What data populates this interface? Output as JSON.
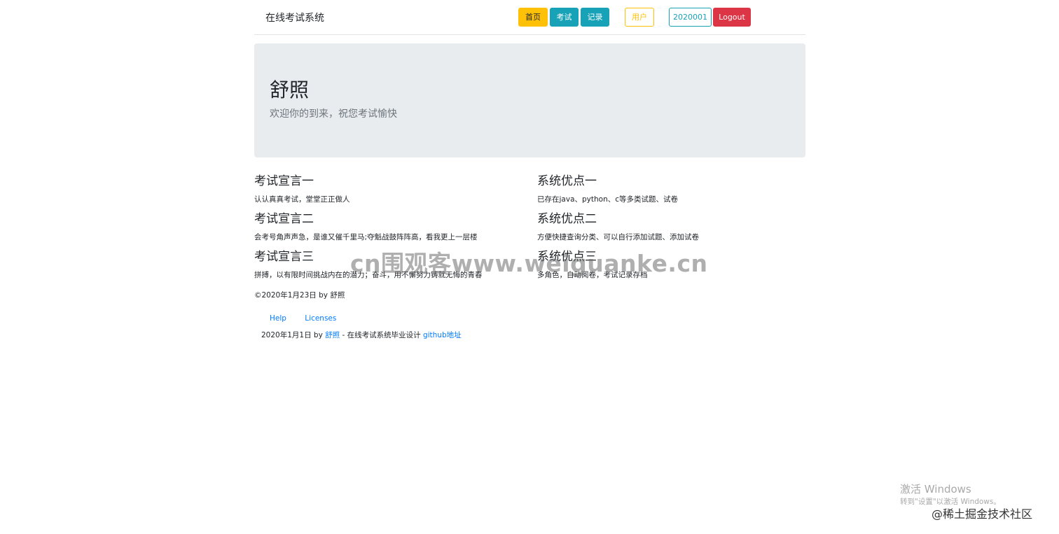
{
  "navbar": {
    "brand": "在线考试系统",
    "home": "首页",
    "exam": "考试",
    "record": "记录",
    "user": "用户",
    "user_id": "2020001",
    "logout": "Logout"
  },
  "jumbotron": {
    "title": "舒照",
    "subtitle": "欢迎你的到来，祝您考试愉快"
  },
  "left_column": [
    {
      "title": "考试宣言一",
      "text": "认认真真考试，堂堂正正做人"
    },
    {
      "title": "考试宣言二",
      "text": "会考号角声声急，是谁又催千里马;夺魁战鼓阵阵高，看我更上一层楼"
    },
    {
      "title": "考试宣言三",
      "text": "拼搏，以有限时间挑战内在的潜力；奋斗，用不懈努力铸就无悔的青春"
    }
  ],
  "right_column": [
    {
      "title": "系统优点一",
      "text": "已存在java、python、c等多类试题、试卷"
    },
    {
      "title": "系统优点二",
      "text": "方便快捷查询分类、可以自行添加试题、添加试卷"
    },
    {
      "title": "系统优点三",
      "text": "多角色，自动阅卷，考试记录存档"
    }
  ],
  "copyright": "©2020年1月23日 by 舒照",
  "footer": {
    "help": "Help",
    "licenses": "Licenses",
    "date_by": "2020年1月1日 by",
    "author": "舒照",
    "description": " - 在线考试系统毕业设计",
    "github": "github地址"
  },
  "watermark": "cn围观客www.weiguanke.cn",
  "windows_activation": {
    "title": "激活 Windows",
    "subtitle": "转到\"设置\"以激活 Windows。"
  },
  "juejin_mark": "@稀土掘金技术社区"
}
